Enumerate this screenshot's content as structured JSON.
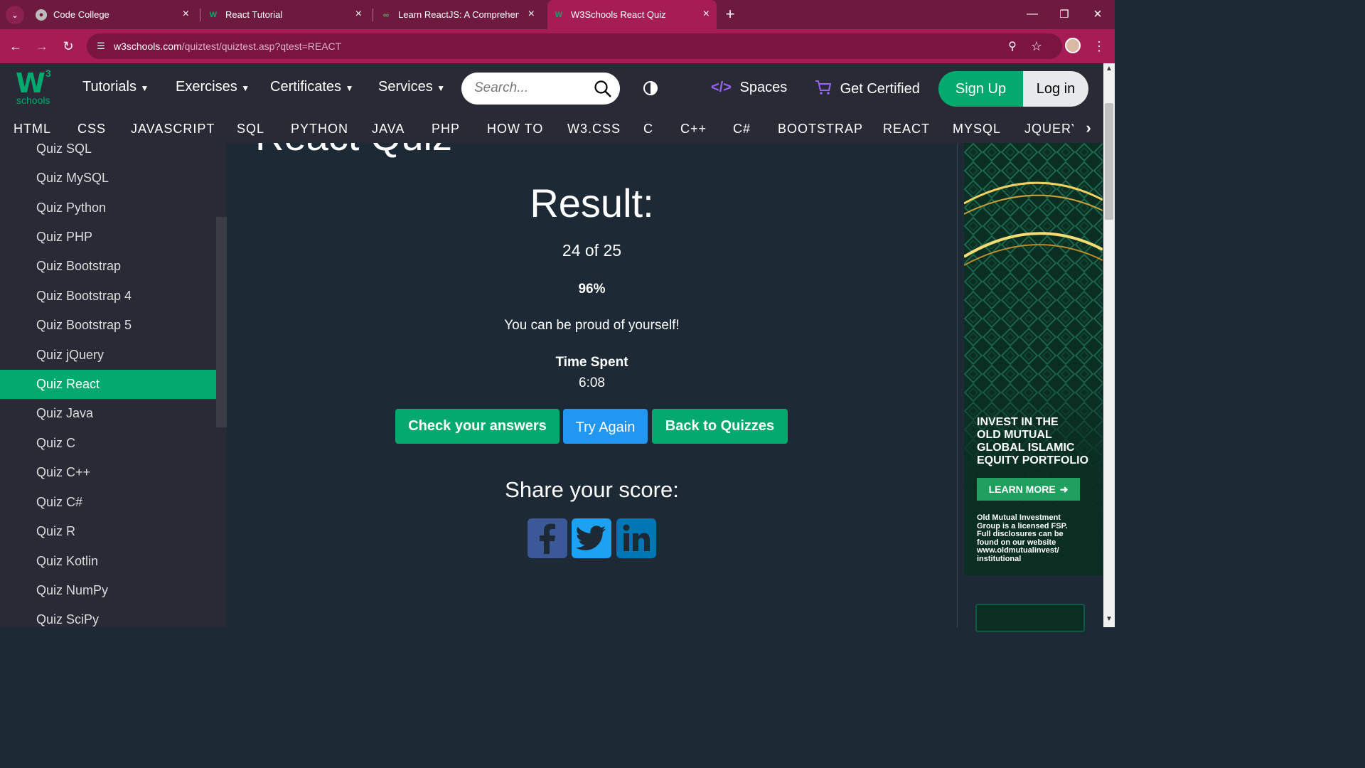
{
  "browser": {
    "tabs": [
      {
        "title": "Code College",
        "favicon": "globe-icon",
        "active": false
      },
      {
        "title": "React Tutorial",
        "favicon": "w3schools-icon",
        "active": false
      },
      {
        "title": "Learn ReactJS: A Comprehensive",
        "favicon": "reactjs-icon",
        "active": false
      },
      {
        "title": "W3Schools React Quiz",
        "favicon": "w3schools-icon",
        "active": true
      }
    ],
    "url_host": "w3schools.com",
    "url_path": "/quiztest/quiztest.asp?qtest=REACT"
  },
  "header": {
    "logo_mark": "W",
    "logo_sup": "3",
    "logo_text": "schools",
    "menus": [
      "Tutorials",
      "Exercises",
      "Certificates",
      "Services"
    ],
    "search_placeholder": "Search...",
    "spaces_label": "Spaces",
    "certified_label": "Get Certified",
    "signup_label": "Sign Up",
    "login_label": "Log in"
  },
  "subnav": [
    "HTML",
    "CSS",
    "JAVASCRIPT",
    "SQL",
    "PYTHON",
    "JAVA",
    "PHP",
    "HOW TO",
    "W3.CSS",
    "C",
    "C++",
    "C#",
    "BOOTSTRAP",
    "REACT",
    "MYSQL",
    "JQUERY"
  ],
  "sidebar": {
    "items": [
      "Quiz SQL",
      "Quiz MySQL",
      "Quiz Python",
      "Quiz PHP",
      "Quiz Bootstrap",
      "Quiz Bootstrap 4",
      "Quiz Bootstrap 5",
      "Quiz jQuery",
      "Quiz React",
      "Quiz Java",
      "Quiz C",
      "Quiz C++",
      "Quiz C#",
      "Quiz R",
      "Quiz Kotlin",
      "Quiz NumPy",
      "Quiz SciPy"
    ],
    "active_item": "Quiz React"
  },
  "main": {
    "page_title": "React Quiz",
    "result_heading": "Result:",
    "score": "24 of 25",
    "percent": "96%",
    "message": "You can be proud of yourself!",
    "time_label": "Time Spent",
    "time_value": "6:08",
    "buttons": {
      "check": "Check your answers",
      "retry": "Try Again",
      "back": "Back to Quizzes"
    },
    "share_heading": "Share your score:"
  },
  "ad": {
    "headline": [
      "INVEST IN THE",
      "OLD MUTUAL",
      "GLOBAL ISLAMIC",
      "EQUITY PORTFOLIO"
    ],
    "cta": "LEARN MORE",
    "disclaimer": [
      "Old Mutual Investment",
      "Group is a licensed FSP.",
      "Full disclosures can be",
      "found on our website",
      "www.oldmutualinvest/",
      "institutional"
    ]
  },
  "colors": {
    "brand_green": "#04aa6d",
    "try_blue": "#2196f3",
    "facebook": "#3b5998",
    "twitter": "#1da1f2",
    "linkedin": "#0077b5"
  }
}
